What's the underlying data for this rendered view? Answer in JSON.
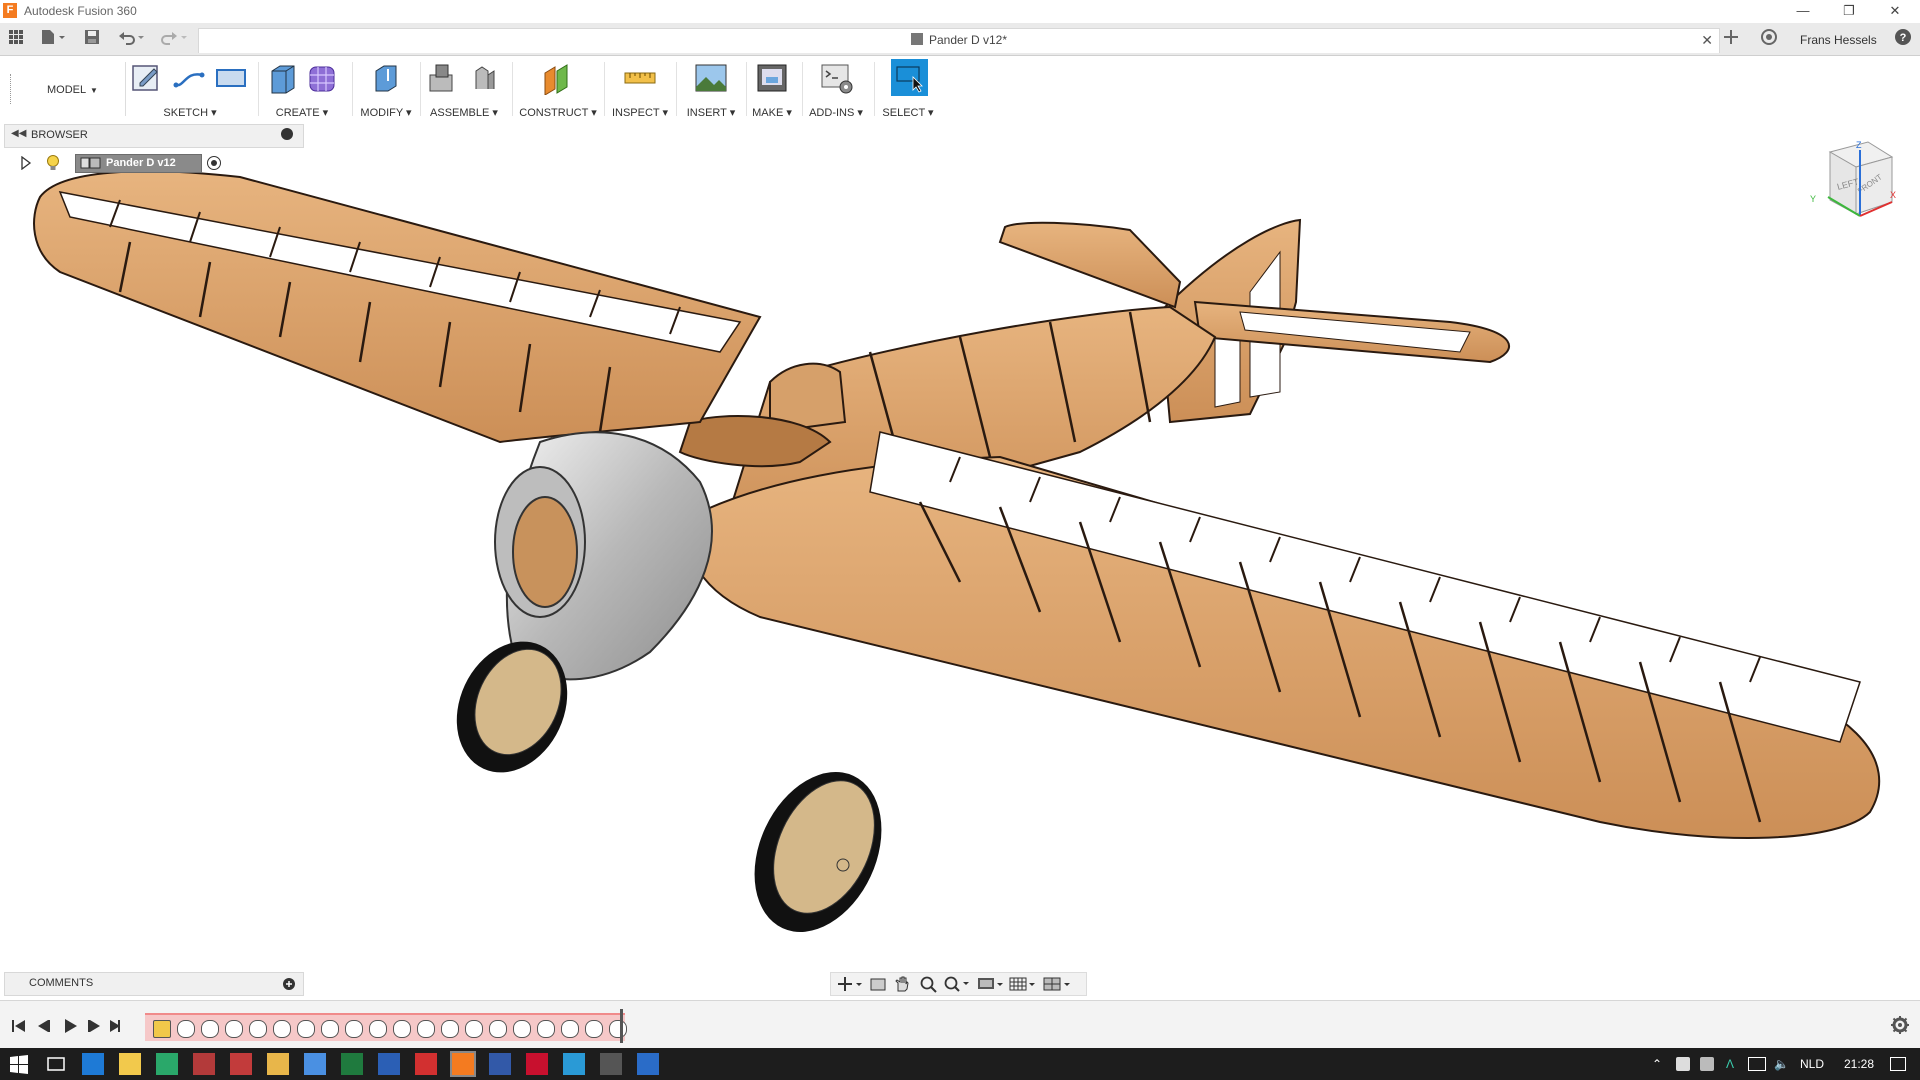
{
  "window": {
    "app_title": "Autodesk Fusion 360"
  },
  "header": {
    "document_title": "Pander D v12*",
    "user_name": "Frans Hessels"
  },
  "toolbar": {
    "workspace": "MODEL",
    "groups": [
      "SKETCH",
      "CREATE",
      "MODIFY",
      "ASSEMBLE",
      "CONSTRUCT",
      "INSPECT",
      "INSERT",
      "MAKE",
      "ADD-INS",
      "SELECT"
    ]
  },
  "browser": {
    "title": "BROWSER",
    "root_component": "Pander D v12"
  },
  "viewcube": {
    "faces": [
      "LEFT",
      "FRONT"
    ],
    "axes": [
      "Z",
      "Y",
      "X"
    ]
  },
  "comments": {
    "title": "COMMENTS"
  },
  "timeline": {
    "feature_count": 20
  },
  "taskbar": {
    "language": "NLD",
    "clock": "21:28",
    "apps": [
      "start-icon",
      "task-view-icon",
      "edge-icon",
      "explorer-icon",
      "cubase-icon",
      "winrar-icon",
      "media-icon",
      "folder-icon",
      "chrome-icon",
      "excel-icon",
      "word-icon",
      "acrobat-icon",
      "fusion-icon",
      "revit-icon",
      "autocad-icon",
      "sketchup-icon",
      "photos-icon",
      "photoshop-icon"
    ]
  },
  "colors": {
    "wood": "#d9a068",
    "select_active": "#1a8fd8",
    "taskbar": "#1d1d1d",
    "cowling": "#c9c9c9"
  }
}
